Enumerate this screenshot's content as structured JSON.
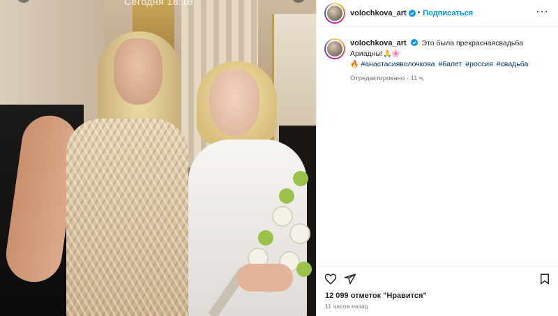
{
  "photo": {
    "status_time": "Сегодня 18:18"
  },
  "post": {
    "username": "volochkova_art",
    "follow_label": "Подписаться",
    "separator": "•",
    "more_label": "···",
    "caption_text": "Это была прекраснаясвадьба Ариадны!",
    "caption_emoji_end": "🙏🌸",
    "caption_emoji_start": "🔥",
    "hashtags": [
      "#анастасияволочкова",
      "#балет",
      "#россия",
      "#свадьба"
    ],
    "edited": "Отредактировано · 11 ч.",
    "likes": "12 099 отметок \"Нравится\"",
    "timestamp": "11 часов назад"
  },
  "colors": {
    "accent": "#0095f6",
    "hashtag": "#00376b",
    "verified": "#0095f6"
  },
  "icons": {
    "like": "heart-icon",
    "share": "send-icon",
    "save": "bookmark-icon",
    "more": "more-icon",
    "verified": "verified-badge-icon"
  }
}
